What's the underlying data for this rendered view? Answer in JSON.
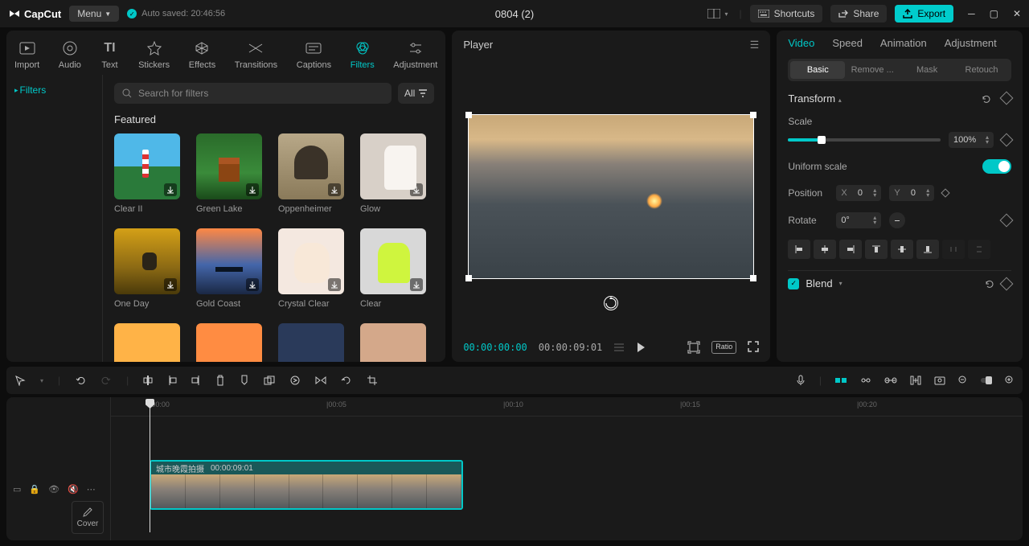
{
  "app_name": "CapCut",
  "menu_label": "Menu",
  "auto_saved": "Auto saved: 20:46:56",
  "project_title": "0804 (2)",
  "topbar": {
    "shortcuts": "Shortcuts",
    "share": "Share",
    "export": "Export"
  },
  "tool_tabs": [
    "Import",
    "Audio",
    "Text",
    "Stickers",
    "Effects",
    "Transitions",
    "Captions",
    "Filters",
    "Adjustment"
  ],
  "left": {
    "category": "Filters",
    "search_placeholder": "Search for filters",
    "all": "All",
    "section": "Featured",
    "filters": [
      "Clear II",
      "Green Lake",
      "Oppenheimer",
      "Glow",
      "One Day",
      "Gold Coast",
      "Crystal Clear",
      "Clear",
      "",
      "",
      "",
      ""
    ]
  },
  "player": {
    "title": "Player",
    "current": "00:00:00:00",
    "duration": "00:00:09:01"
  },
  "right": {
    "tabs": [
      "Video",
      "Speed",
      "Animation",
      "Adjustment"
    ],
    "sub_tabs": [
      "Basic",
      "Remove ...",
      "Mask",
      "Retouch"
    ],
    "transform": "Transform",
    "scale_label": "Scale",
    "scale_value": "100%",
    "uniform_scale": "Uniform scale",
    "position": "Position",
    "pos_x_label": "X",
    "pos_x": "0",
    "pos_y_label": "Y",
    "pos_y": "0",
    "rotate": "Rotate",
    "rotate_value": "0°",
    "blend": "Blend"
  },
  "timeline": {
    "cover": "Cover",
    "marks": [
      "|00:00",
      "|00:05",
      "|00:10",
      "|00:15",
      "|00:20"
    ],
    "clip_name": "城市晚霞拍摄",
    "clip_dur": "00:00:09:01"
  }
}
